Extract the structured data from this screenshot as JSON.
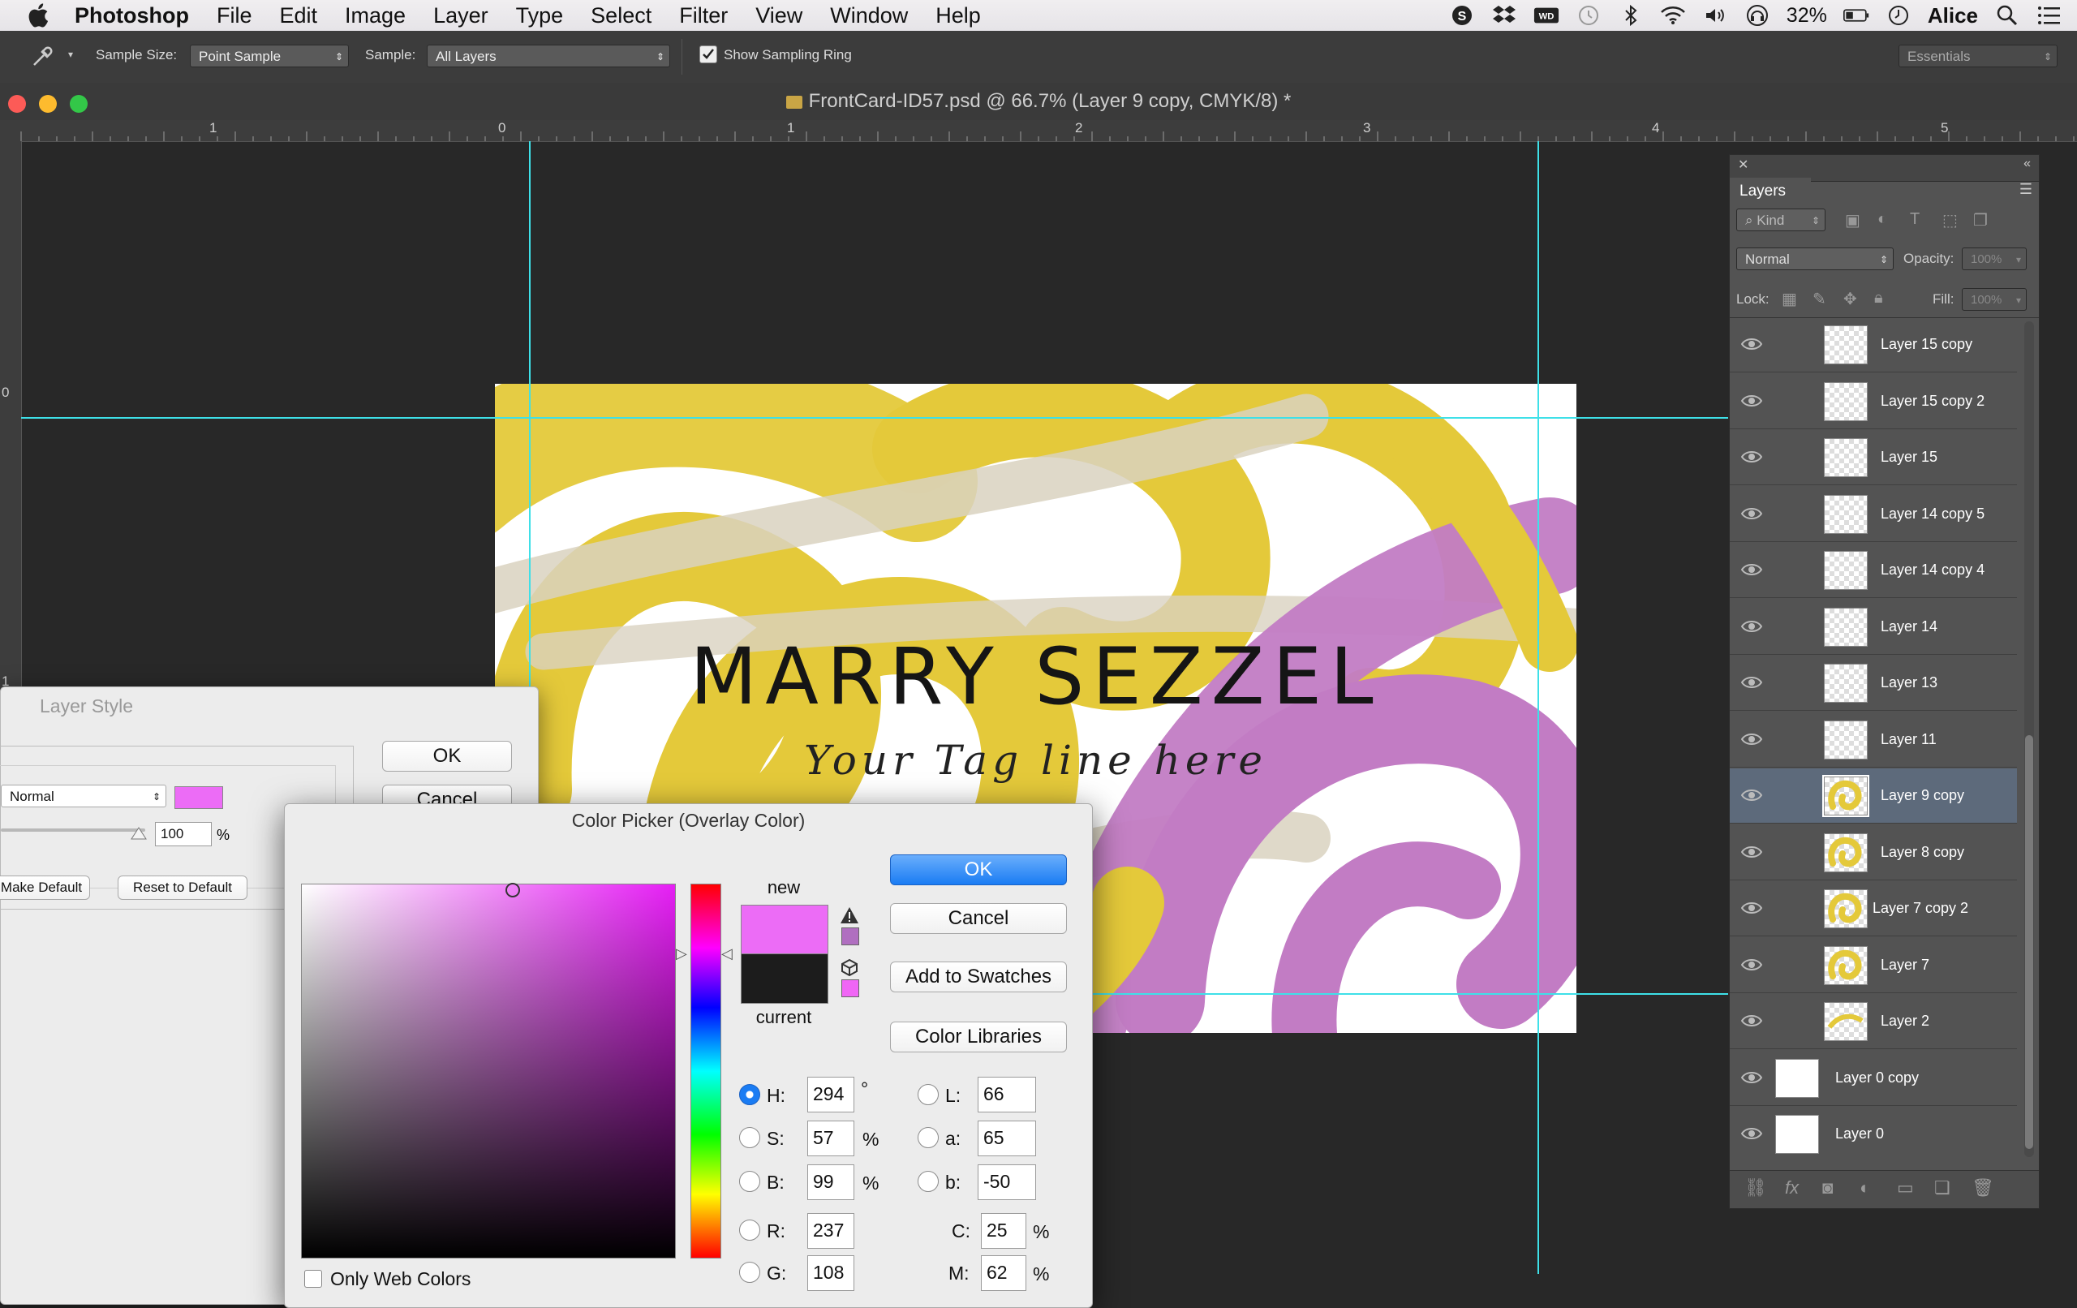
{
  "menubar": {
    "app_name": "Photoshop",
    "items": [
      "File",
      "Edit",
      "Image",
      "Layer",
      "Type",
      "Select",
      "Filter",
      "View",
      "Window",
      "Help"
    ],
    "battery": "32%",
    "user": "Alice"
  },
  "options": {
    "sample_size_label": "Sample Size:",
    "sample_size_value": "Point Sample",
    "sample_label": "Sample:",
    "sample_value": "All Layers",
    "show_ring_label": "Show Sampling Ring",
    "workspace": "Essentials"
  },
  "document": {
    "title": "FrontCard-ID57.psd @ 66.7% (Layer 9 copy, CMYK/8) *"
  },
  "ruler": {
    "h_labels": [
      "1",
      "0",
      "1",
      "2",
      "3",
      "4",
      "5"
    ],
    "v_labels": [
      "0",
      "1"
    ]
  },
  "card": {
    "name": "MARRY SEZZEL",
    "tagline": "Your Tag line here"
  },
  "layers_panel": {
    "title": "Layers",
    "filter": "Kind",
    "blend_mode": "Normal",
    "opacity_label": "Opacity:",
    "opacity_value": "100%",
    "lock_label": "Lock:",
    "fill_label": "Fill:",
    "fill_value": "100%",
    "layers": [
      {
        "name": "Layer 15 copy"
      },
      {
        "name": "Layer 15 copy 2"
      },
      {
        "name": "Layer 15"
      },
      {
        "name": "Layer 14 copy 5"
      },
      {
        "name": "Layer 14 copy 4"
      },
      {
        "name": "Layer 14"
      },
      {
        "name": "Layer 13"
      },
      {
        "name": "Layer 11"
      },
      {
        "name": "Layer 9 copy"
      },
      {
        "name": "Layer 8 copy"
      },
      {
        "name": "Layer 7 copy 2"
      },
      {
        "name": "Layer 7"
      },
      {
        "name": "Layer 2"
      },
      {
        "name": "Layer 0 copy"
      },
      {
        "name": "Layer 0"
      }
    ]
  },
  "layer_style": {
    "title": "Layer Style",
    "ok": "OK",
    "cancel": "Cancel",
    "blend_mode": "Normal",
    "opacity_value": "100",
    "percent": "%",
    "make_default": "Make Default",
    "reset_default": "Reset to Default"
  },
  "color_picker": {
    "title": "Color Picker (Overlay Color)",
    "new_label": "new",
    "current_label": "current",
    "ok": "OK",
    "cancel": "Cancel",
    "add_swatches": "Add to Swatches",
    "color_libraries": "Color Libraries",
    "only_web": "Only Web Colors",
    "new_color": "#ec6cf6",
    "current_color": "#1c1c1c",
    "H": "294",
    "S": "57",
    "B": "99",
    "R": "237",
    "G": "108",
    "L": "66",
    "a": "65",
    "b": "-50",
    "C": "25",
    "M": "62",
    "deg": "°",
    "pct": "%",
    "labels": {
      "H": "H:",
      "S": "S:",
      "B": "B:",
      "R": "R:",
      "G": "G:",
      "L": "L:",
      "a": "a:",
      "b": "b:",
      "C": "C:",
      "M": "M:"
    }
  },
  "colors": {
    "accent_blue": "#1a7cf3",
    "guide": "#3ee0e8",
    "yellow": "#e4c93a",
    "purple": "#c27cc4",
    "beige": "#d9d2c0"
  }
}
